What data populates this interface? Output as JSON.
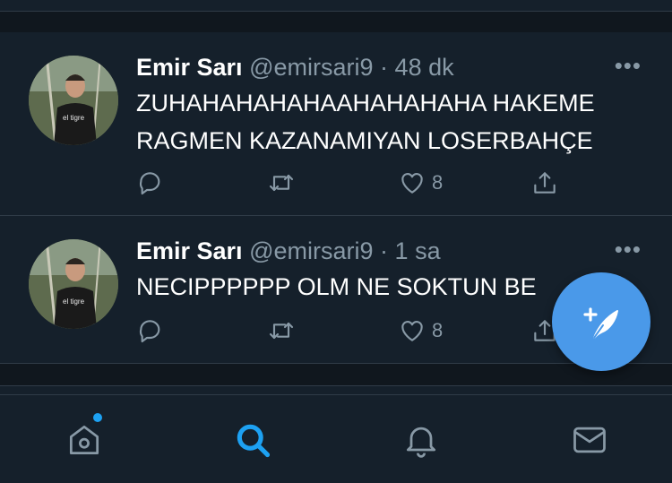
{
  "tweets": [
    {
      "name": "Emir Sarı",
      "handle": "@emirsari9",
      "separator": "·",
      "time": "48 dk",
      "text_lines": [
        "ZUHAHAHAHAHAAHAHAHAHA HAKEME",
        "RAGMEN KAZANAMIYAN LOSERBAHÇE"
      ],
      "like_count": "8"
    },
    {
      "name": "Emir Sarı",
      "handle": "@emirsari9",
      "separator": "·",
      "time": "1 sa",
      "text_lines": [
        "NECIPPPPPP OLM NE SOKTUN BE"
      ],
      "like_count": "8"
    }
  ],
  "icons": {
    "reply": "reply-icon",
    "retweet": "retweet-icon",
    "like": "heart-icon",
    "share": "share-icon",
    "more": "more-icon",
    "compose": "compose-tweet-icon",
    "nav": [
      "home-icon",
      "search-icon",
      "notifications-icon",
      "messages-icon"
    ]
  },
  "colors": {
    "background": "#15202b",
    "secondary_text": "#8899a6",
    "accent": "#1da1f2",
    "fab": "#4a99e9"
  }
}
